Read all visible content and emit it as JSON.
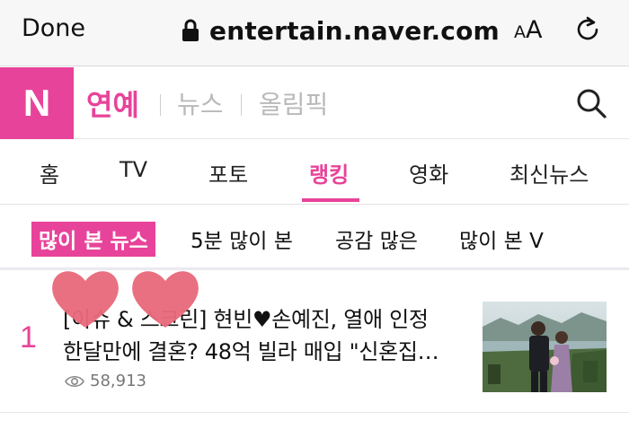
{
  "browser": {
    "done_label": "Done",
    "url": "entertain.naver.com",
    "text_size_small": "A",
    "text_size_big": "A"
  },
  "header": {
    "logo": "N",
    "sections": [
      {
        "label": "연예",
        "active": true
      },
      {
        "label": "뉴스",
        "active": false
      },
      {
        "label": "올림픽",
        "active": false
      }
    ]
  },
  "tabs": [
    {
      "label": "홈"
    },
    {
      "label": "TV"
    },
    {
      "label": "포토"
    },
    {
      "label": "랭킹",
      "active": true
    },
    {
      "label": "영화"
    },
    {
      "label": "최신뉴스"
    }
  ],
  "subtabs": [
    {
      "label": "많이 본 뉴스",
      "active": true
    },
    {
      "label": "5분 많이 본"
    },
    {
      "label": "공감 많은"
    },
    {
      "label": "많이 본 V"
    }
  ],
  "article": {
    "rank": "1",
    "title_line1": "[이슈 & 스크린] 현빈♥손예진, 열애 인정",
    "title_line2": "한달만에 결혼? 48억 빌라 매입 \"신혼집…",
    "views": "58,913"
  },
  "colors": {
    "accent": "#e8439a",
    "heart": "#e86a7b"
  },
  "icons": {
    "lock": "lock-icon",
    "reload": "reload-icon",
    "search": "search-icon",
    "eye": "eye-icon"
  }
}
